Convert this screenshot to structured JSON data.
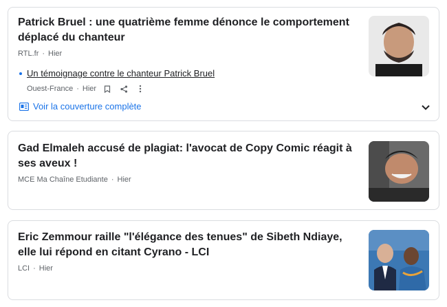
{
  "articles": [
    {
      "headline": "Patrick Bruel : une quatrième femme dénonce le comportement déplacé du chanteur",
      "source": "RTL.fr",
      "time": "Hier",
      "related": {
        "title": "Un témoignage contre le chanteur Patrick Bruel",
        "source": "Ouest-France",
        "time": "Hier"
      },
      "coverage_label": "Voir la couverture complète"
    },
    {
      "headline": "Gad Elmaleh accusé de plagiat: l'avocat de Copy Comic réagit à ses aveux !",
      "source": "MCE Ma Chaîne Etudiante",
      "time": "Hier"
    },
    {
      "headline": "Eric Zemmour raille \"l'élégance des tenues\" de Sibeth Ndiaye, elle lui répond en citant Cyrano - LCI",
      "source": "LCI",
      "time": "Hier"
    }
  ],
  "separator": "·",
  "icons": {
    "bookmark": "bookmark-icon",
    "share": "share-icon",
    "more": "more-vert-icon",
    "coverage": "newspaper-icon",
    "expand": "chevron-down-icon"
  },
  "colors": {
    "link": "#1a73e8",
    "meta": "#5f6368",
    "text": "#202124",
    "border": "#dadce0"
  }
}
